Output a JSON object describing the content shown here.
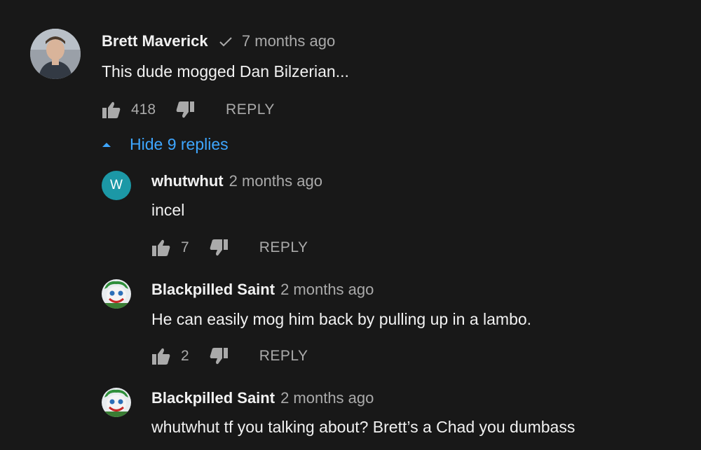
{
  "comments": [
    {
      "author": "Brett Maverick",
      "time": "7 months ago",
      "text": "This dude mogged Dan Bilzerian...",
      "likes": "418",
      "reply_label": "REPLY"
    }
  ],
  "replies_toggle": {
    "label": "Hide 9 replies"
  },
  "replies": [
    {
      "author": "whutwhut",
      "avatar_letter": "W",
      "time": "2 months ago",
      "text": "incel",
      "likes": "7",
      "reply_label": "REPLY"
    },
    {
      "author": "Blackpilled Saint",
      "time": "2 months ago",
      "text": "He can easily mog him back by pulling up in a lambo.",
      "likes": "2",
      "reply_label": "REPLY"
    },
    {
      "author": "Blackpilled Saint",
      "time": "2 months ago",
      "text": "whutwhut tf you talking about? Brett’s a Chad you dumbass"
    }
  ],
  "colors": {
    "background": "#181818",
    "link_blue": "#3ea6ff",
    "secondary_text": "#aaaaaa",
    "letter_avatar": "#1c98a6"
  }
}
